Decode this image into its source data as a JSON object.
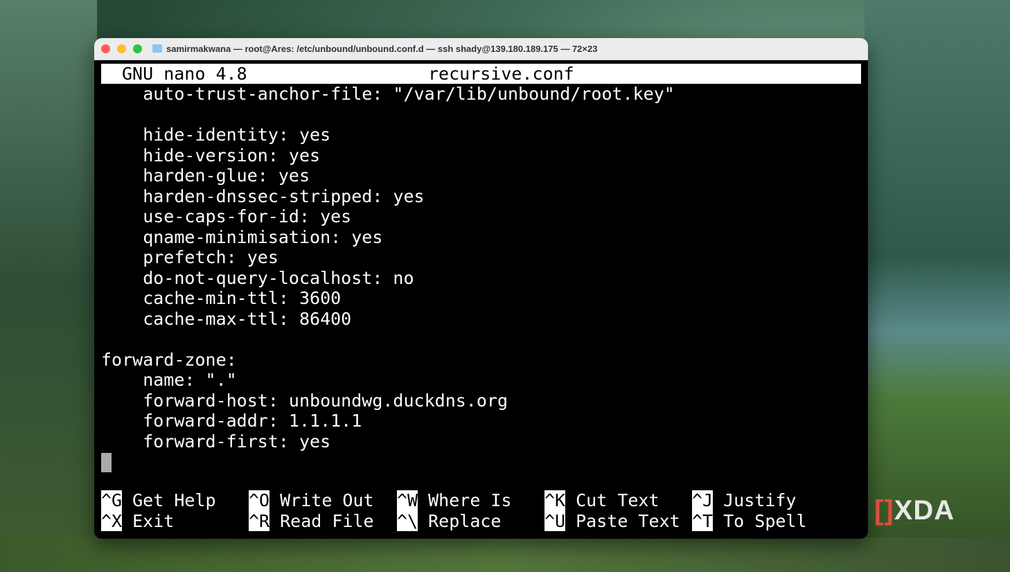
{
  "window": {
    "title": "samirmakwana — root@Ares: /etc/unbound/unbound.conf.d — ssh shady@139.180.189.175 — 72×23"
  },
  "nano": {
    "app": "GNU nano 4.8",
    "filename": "recursive.conf"
  },
  "lines": [
    "    auto-trust-anchor-file: \"/var/lib/unbound/root.key\"",
    "",
    "    hide-identity: yes",
    "    hide-version: yes",
    "    harden-glue: yes",
    "    harden-dnssec-stripped: yes",
    "    use-caps-for-id: yes",
    "    qname-minimisation: yes",
    "    prefetch: yes",
    "    do-not-query-localhost: no",
    "    cache-min-ttl: 3600",
    "    cache-max-ttl: 86400",
    "",
    "forward-zone:",
    "    name: \".\"",
    "    forward-host: unboundwg.duckdns.org",
    "    forward-addr: 1.1.1.1",
    "    forward-first: yes"
  ],
  "shortcuts": [
    [
      {
        "key": "^G",
        "label": "Get Help"
      },
      {
        "key": "^O",
        "label": "Write Out"
      },
      {
        "key": "^W",
        "label": "Where Is"
      },
      {
        "key": "^K",
        "label": "Cut Text"
      },
      {
        "key": "^J",
        "label": "Justify"
      }
    ],
    [
      {
        "key": "^X",
        "label": "Exit"
      },
      {
        "key": "^R",
        "label": "Read File"
      },
      {
        "key": "^\\",
        "label": "Replace"
      },
      {
        "key": "^U",
        "label": "Paste Text"
      },
      {
        "key": "^T",
        "label": "To Spell"
      }
    ]
  ],
  "watermark": "XDA"
}
